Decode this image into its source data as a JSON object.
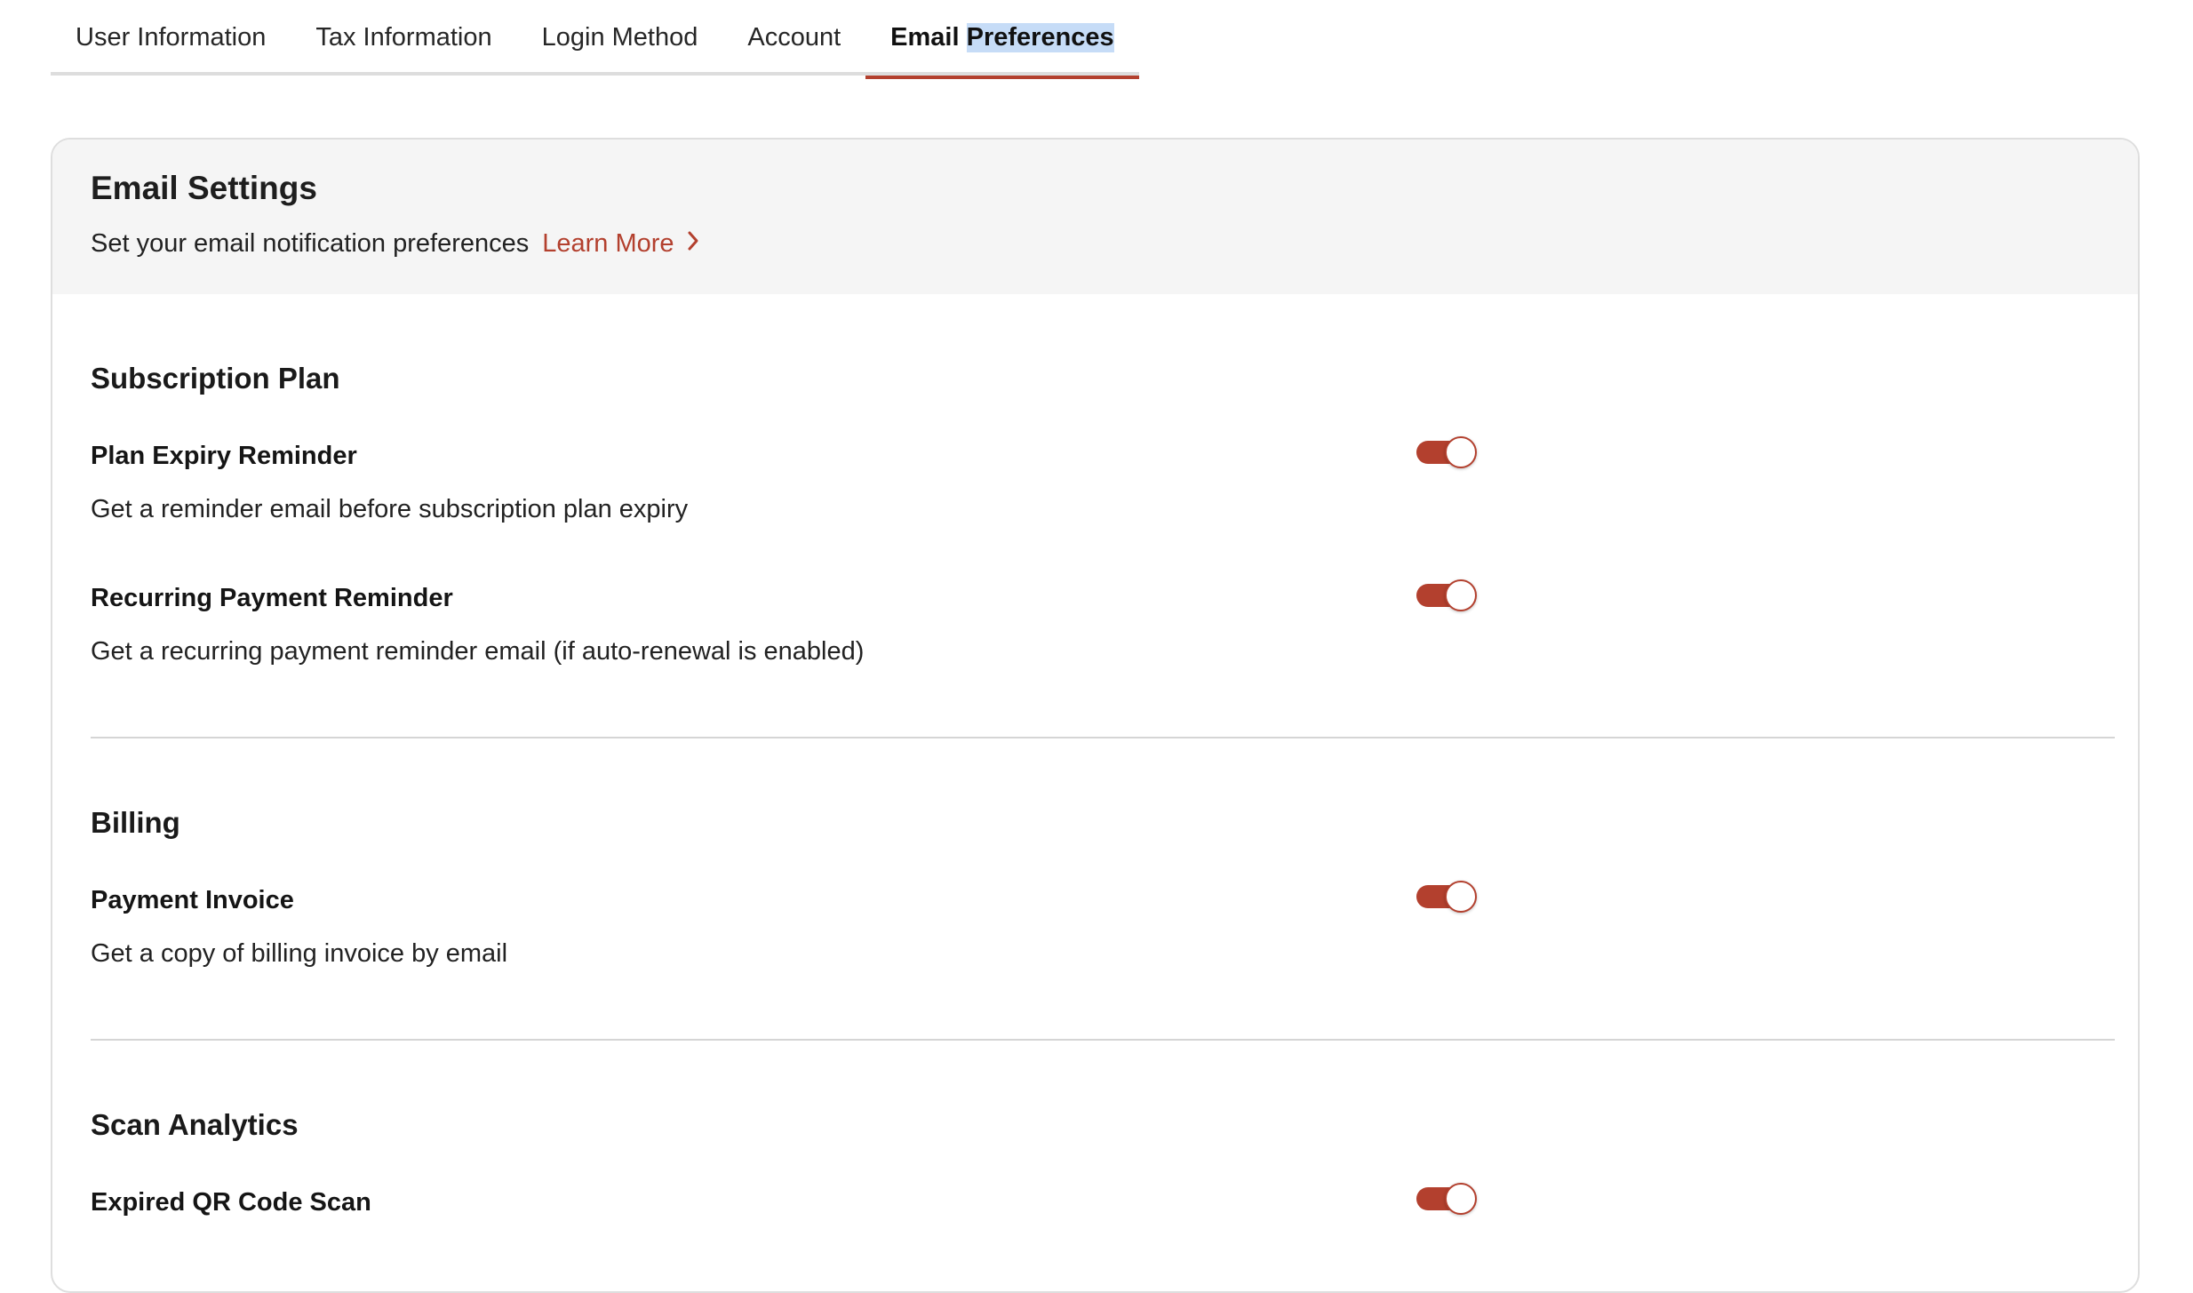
{
  "tabs": [
    {
      "label": "User Information"
    },
    {
      "label": "Tax Information"
    },
    {
      "label": "Login Method"
    },
    {
      "label": "Account"
    },
    {
      "label_part1": "Email ",
      "label_part2": "Preferences",
      "active": true
    }
  ],
  "card": {
    "title": "Email Settings",
    "subtitle": "Set your email notification preferences",
    "learn_more": "Learn More"
  },
  "sections": {
    "subscription": {
      "title": "Subscription Plan",
      "items": [
        {
          "title": "Plan Expiry Reminder",
          "desc": "Get a reminder email before subscription plan expiry",
          "enabled": true
        },
        {
          "title": "Recurring Payment Reminder",
          "desc": "Get a recurring payment reminder email (if auto-renewal is enabled)",
          "enabled": true
        }
      ]
    },
    "billing": {
      "title": "Billing",
      "items": [
        {
          "title": "Payment Invoice",
          "desc": "Get a copy of billing invoice by email",
          "enabled": true
        }
      ]
    },
    "scan": {
      "title": "Scan Analytics",
      "items": [
        {
          "title": "Expired QR Code Scan",
          "enabled": true
        }
      ]
    }
  },
  "colors": {
    "accent": "#b3402e",
    "selection_highlight": "#c6dcf7",
    "header_bg": "#f5f5f5"
  }
}
